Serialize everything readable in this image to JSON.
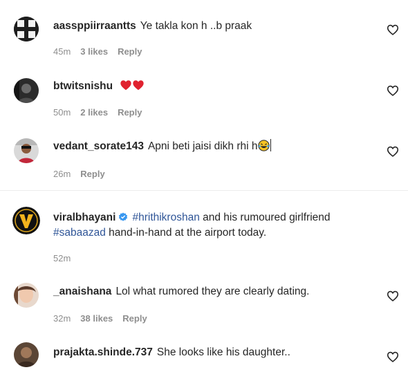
{
  "comments": [
    {
      "username": "aassppiirraantts",
      "text": "Ye takla kon h ..b praak",
      "time": "45m",
      "likes": "3 likes",
      "reply": "Reply"
    },
    {
      "username": "btwitsnishu",
      "text": "",
      "emoji": "red-heart x2",
      "time": "50m",
      "likes": "2 likes",
      "reply": "Reply"
    },
    {
      "username": "vedant_sorate143",
      "text": "Apni beti jaisi dikh rhi h",
      "emoji": "laughing-tears",
      "time": "26m",
      "reply": "Reply"
    },
    {
      "username": "viralbhayani",
      "verified": true,
      "hashtag1": "#hrithikroshan",
      "text1": " and his rumoured girlfriend",
      "hashtag2": "#sabaazad",
      "text2": " hand-in-hand at the airport today.",
      "time": "52m"
    },
    {
      "username": "_anaishana",
      "text": "Lol what rumored they are clearly dating.",
      "time": "32m",
      "likes": "38 likes",
      "reply": "Reply"
    },
    {
      "username": "prajakta.shinde.737",
      "text": "She looks like his daughter..",
      "time": "",
      "reply": ""
    }
  ],
  "colors": {
    "text": "#262626",
    "meta": "#8e8e8e",
    "hashtag": "#2f5597",
    "heart": "#ed4956",
    "verified": "#3897f0"
  },
  "icons": {
    "like": "heart-outline-icon",
    "verified": "verified-badge-icon"
  }
}
